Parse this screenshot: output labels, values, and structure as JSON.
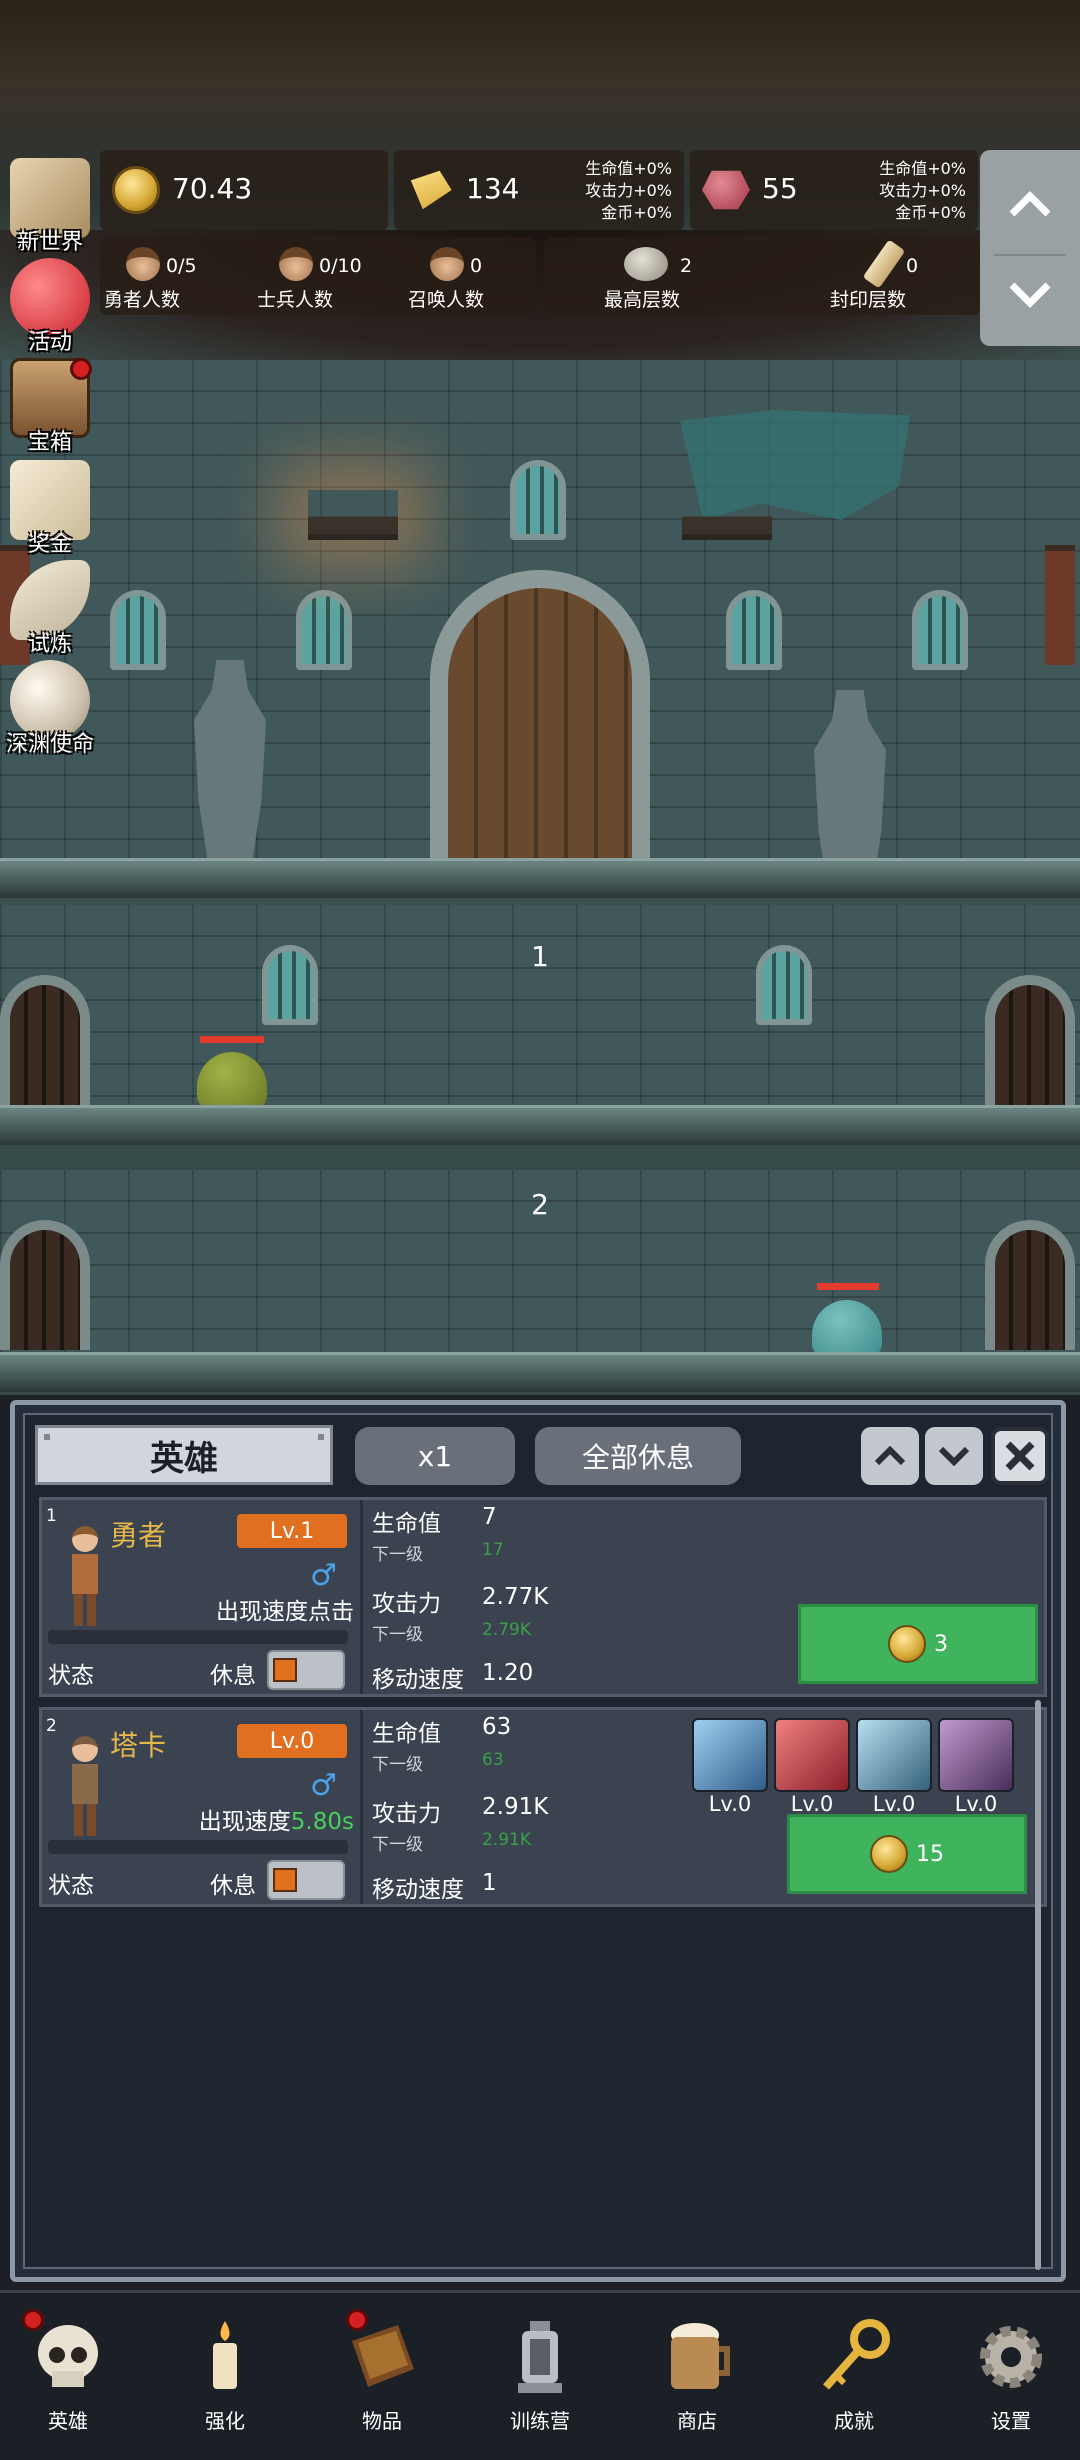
{
  "resources": {
    "coin": {
      "value": "70.43",
      "icon": "coin-icon"
    },
    "gold": {
      "value": "134",
      "icon": "gold-bar-icon",
      "bonus": [
        "生命值+0%",
        "攻击力+0%",
        "金币+0%"
      ]
    },
    "gem": {
      "value": "55",
      "icon": "gem-icon",
      "bonus": [
        "生命值+0%",
        "攻击力+0%",
        "金币+0%"
      ]
    }
  },
  "counts": {
    "heroes": {
      "value": "0/5",
      "label": "勇者人数"
    },
    "soldiers": {
      "value": "0/10",
      "label": "士兵人数"
    },
    "summons": {
      "value": "0",
      "label": "召唤人数"
    },
    "max_floor": {
      "value": "2",
      "label": "最高层数"
    },
    "sealed_floor": {
      "value": "0",
      "label": "封印层数"
    }
  },
  "side_menu": [
    {
      "label": "新世界",
      "icon": "map-icon",
      "badge": false
    },
    {
      "label": "活动",
      "icon": "heart-icon",
      "badge": false
    },
    {
      "label": "宝箱",
      "icon": "chest-icon",
      "badge": true
    },
    {
      "label": "奖金",
      "icon": "envelope-icon",
      "badge": false
    },
    {
      "label": "试炼",
      "icon": "wing-icon",
      "badge": false
    },
    {
      "label": "深渊使命",
      "icon": "pearl-icon",
      "badge": false
    }
  ],
  "scene": {
    "floors": [
      "1",
      "2"
    ],
    "monster_hp": [
      1.0,
      1.0
    ]
  },
  "panel": {
    "tab": "英雄",
    "speed": "x1",
    "rest_all": "全部休息",
    "up_icon": "chevron-up-icon",
    "down_icon": "chevron-down-icon",
    "close_icon": "close-icon"
  },
  "heroes": [
    {
      "index": "1",
      "name": "勇者",
      "level": "Lv.1",
      "appear_text": "出现速度点击",
      "appear_time": "",
      "state_label": "状态",
      "rest_label": "休息",
      "hp_label": "生命值",
      "hp": "7",
      "hp_next_label": "下一级",
      "hp_next": "17",
      "atk_label": "攻击力",
      "atk": "2.77K",
      "atk_next_label": "下一级",
      "atk_next": "2.79K",
      "speed_label": "移动速度",
      "speed": "1.20",
      "cost": "3"
    },
    {
      "index": "2",
      "name": "塔卡",
      "level": "Lv.0",
      "appear_text": "出现速度",
      "appear_time": "5.80s",
      "state_label": "状态",
      "rest_label": "休息",
      "hp_label": "生命值",
      "hp": "63",
      "hp_next_label": "下一级",
      "hp_next": "63",
      "atk_label": "攻击力",
      "atk": "2.91K",
      "atk_next_label": "下一级",
      "atk_next": "2.91K",
      "speed_label": "移动速度",
      "speed": "1",
      "cost": "15",
      "skills": [
        {
          "icon": "shield-skill-icon",
          "level": "Lv.0",
          "color": "#4f7fb3"
        },
        {
          "icon": "axe-skill-icon",
          "level": "Lv.0",
          "color": "#b8404a"
        },
        {
          "icon": "boot-skill-icon",
          "level": "Lv.0",
          "color": "#5c8aa8"
        },
        {
          "icon": "hammer-skill-icon",
          "level": "Lv.0",
          "color": "#6a4e7a"
        }
      ]
    }
  ],
  "nav": [
    {
      "label": "英雄",
      "icon": "skull-icon",
      "badge": true
    },
    {
      "label": "强化",
      "icon": "candle-icon",
      "badge": false
    },
    {
      "label": "物品",
      "icon": "book-icon",
      "badge": true
    },
    {
      "label": "训练营",
      "icon": "lantern-icon",
      "badge": false
    },
    {
      "label": "商店",
      "icon": "beer-mug-icon",
      "badge": false
    },
    {
      "label": "成就",
      "icon": "key-icon",
      "badge": false
    },
    {
      "label": "设置",
      "icon": "gear-icon",
      "badge": false
    }
  ]
}
